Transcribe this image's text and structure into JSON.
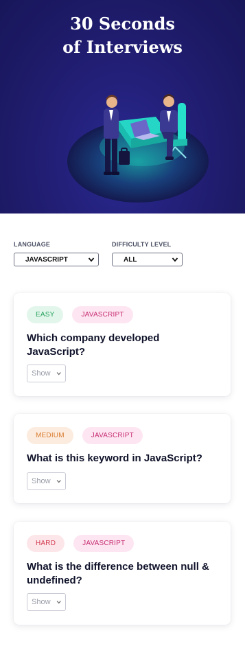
{
  "hero": {
    "title_line1": "30 Seconds",
    "title_line2": "of Interviews",
    "background_color": "#1d1a66"
  },
  "filters": {
    "language": {
      "label": "LANGUAGE",
      "selected": "JAVASCRIPT"
    },
    "difficulty": {
      "label": "DIFFICULTY LEVEL",
      "selected": "ALL"
    }
  },
  "cards": [
    {
      "difficulty": "EASY",
      "language": "JAVASCRIPT",
      "question": "Which company developed JavaScript?",
      "show_label": "Show"
    },
    {
      "difficulty": "MEDIUM",
      "language": "JAVASCRIPT",
      "question": "What is this keyword in JavaScript?",
      "show_label": "Show"
    },
    {
      "difficulty": "HARD",
      "language": "JAVASCRIPT",
      "question": "What is the difference between null & undefined?",
      "show_label": "Show"
    }
  ],
  "colors": {
    "easy": "#26a15b",
    "medium": "#d97b2e",
    "hard": "#d23a4f",
    "language": "#c72d74",
    "accent_teal": "#1fd6c4"
  },
  "icons": {
    "select_caret": "chevron-down-icon",
    "illustration": "interview-illustration"
  }
}
